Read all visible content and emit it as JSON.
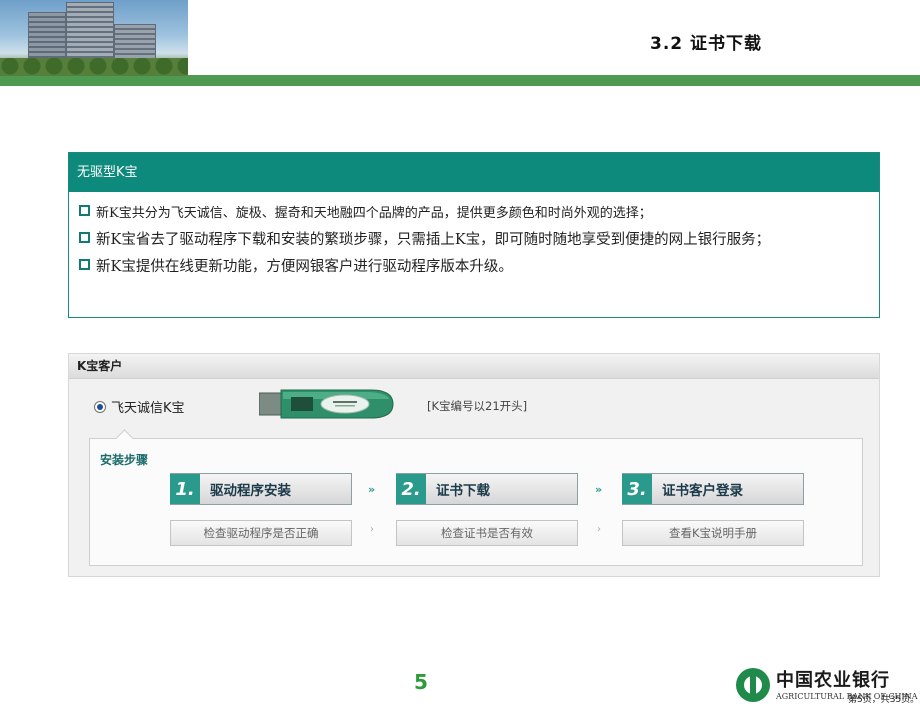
{
  "header": {
    "title": "3.2 证书下载"
  },
  "info": {
    "title": "无驱型K宝",
    "items": [
      "新K宝共分为飞天诚信、旋极、握奇和天地融四个品牌的产品，提供更多颜色和时尚外观的选择；",
      "新K宝省去了驱动程序下载和安装的繁琐步骤，只需插上K宝，即可随时随地享受到便捷的网上银行服务；",
      "新K宝提供在线更新功能，方便网银客户进行驱动程序版本升级。"
    ]
  },
  "panel": {
    "title": "K宝客户",
    "option_label": "飞天诚信K宝",
    "note": "[K宝编号以21开头]",
    "section_title": "安装步骤",
    "steps": [
      {
        "num": "1.",
        "label": "驱动程序安装"
      },
      {
        "num": "2.",
        "label": "证书下载"
      },
      {
        "num": "3.",
        "label": "证书客户登录"
      }
    ],
    "arrow": "»",
    "sub_actions": [
      "检查驱动程序是否正确",
      "检查证书是否有效",
      "查看K宝说明手册"
    ],
    "separator": "›"
  },
  "footer": {
    "page_number": "5",
    "bank_name_cn": "中国农业银行",
    "bank_name_en": "AGRICULTURAL BANK OF CHINA",
    "page_info": "第5页，共35页。"
  },
  "colors": {
    "brand_green": "#4f9a51",
    "teal": "#0e8a7c"
  }
}
